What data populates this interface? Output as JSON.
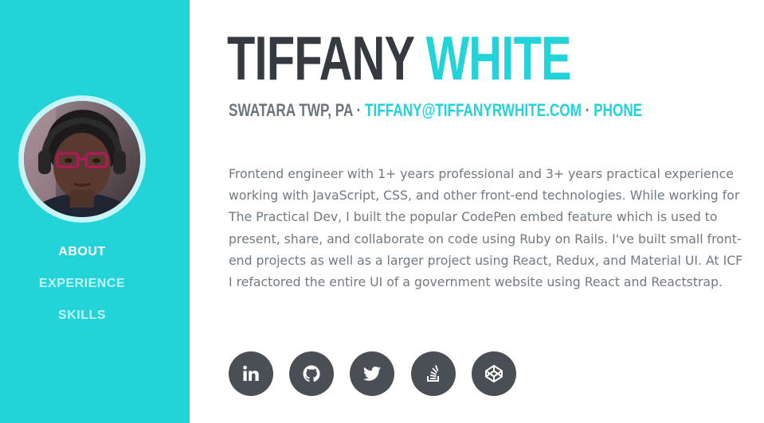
{
  "sidebar": {
    "background_color": "#22d3d8",
    "avatar_alt": "profile-photo",
    "nav": [
      {
        "label": "ABOUT",
        "active": true
      },
      {
        "label": "EXPERIENCE",
        "active": false
      },
      {
        "label": "SKILLS",
        "active": false
      }
    ]
  },
  "header": {
    "first_name": "TIFFANY",
    "last_name": "WHITE",
    "location": "SWATARA TWP, PA",
    "separator": "·",
    "email": "TIFFANY@TIFFANYRWHITE.COM",
    "phone": "PHONE"
  },
  "about": {
    "bio": "Frontend engineer with 1+ years professional and 3+ years practical experience working with JavaScript, CSS, and other front-end technologies. While working for The Practical Dev, I built the popular CodePen embed feature which is used to present, share, and collaborate on code using Ruby on Rails. I've built small front-end projects as well as a larger project using React, Redux, and Material UI. At ICF I refactored the entire UI of a government website using React and Reactstrap."
  },
  "social": [
    {
      "icon": "linkedin-icon"
    },
    {
      "icon": "github-icon"
    },
    {
      "icon": "twitter-icon"
    },
    {
      "icon": "stackoverflow-icon"
    },
    {
      "icon": "codepen-icon"
    }
  ],
  "colors": {
    "accent": "#22d3d8",
    "dark": "#353a40",
    "muted": "#707a82",
    "social_bg": "#4a4f55"
  }
}
